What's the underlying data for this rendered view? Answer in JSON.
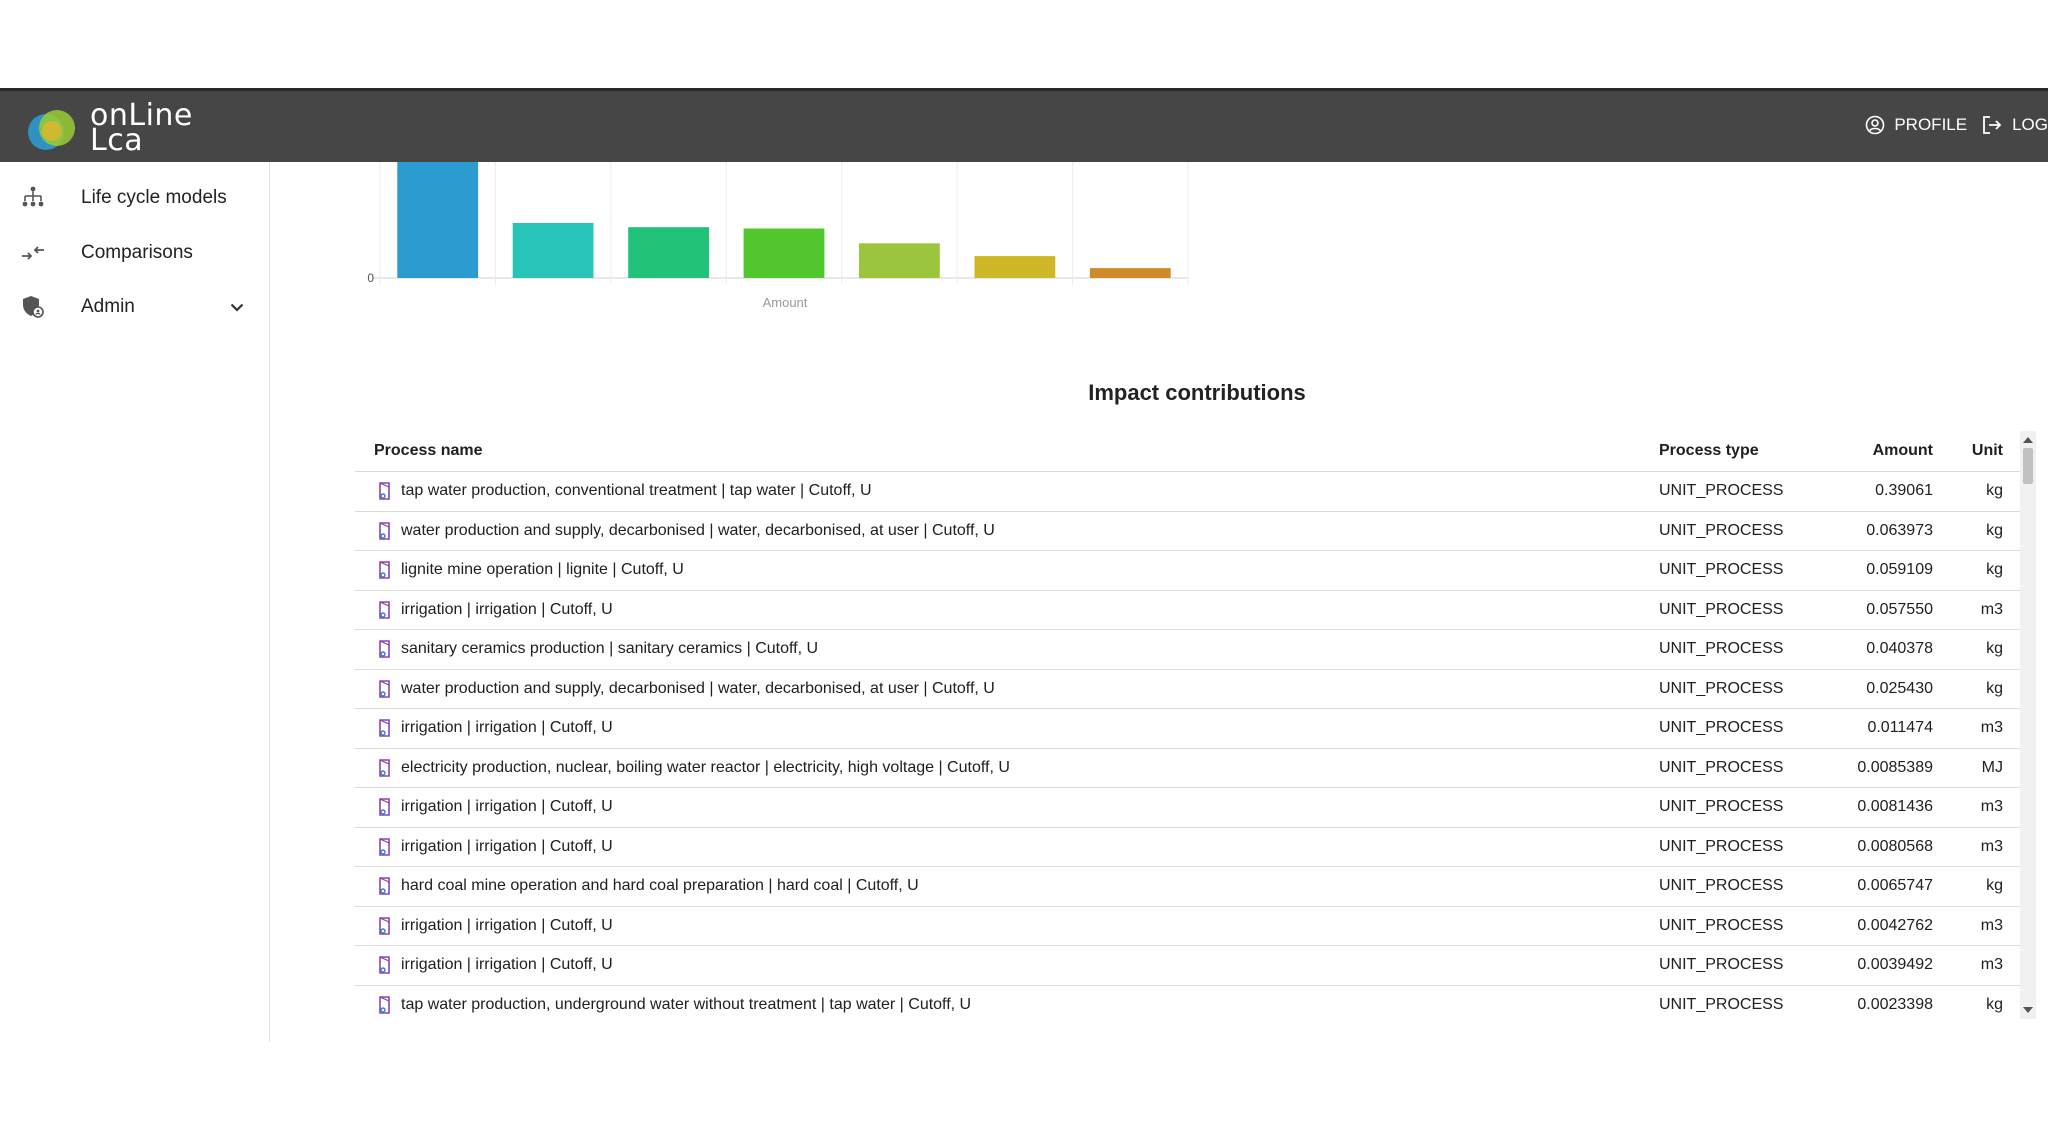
{
  "app": {
    "logo_line1": "onLine",
    "logo_line2": "Lca"
  },
  "header": {
    "profile_label": "PROFILE",
    "logout_label": "LOG"
  },
  "sidebar": {
    "items": [
      {
        "label": "Life cycle models",
        "icon": "sitemap-icon"
      },
      {
        "label": "Comparisons",
        "icon": "compare-arrows-icon"
      },
      {
        "label": "Admin",
        "icon": "admin-shield-icon"
      }
    ]
  },
  "chart_data": {
    "type": "bar",
    "xlabel": "Amount",
    "y_tick_labels": [
      "0"
    ],
    "values": [
      0.39061,
      0.063973,
      0.059109,
      0.05755,
      0.040378,
      0.02543,
      0.011474
    ],
    "colors": [
      "#2b9bd0",
      "#29c4b8",
      "#22c27a",
      "#52c72d",
      "#9cc43c",
      "#cfb828",
      "#cf8a2a"
    ]
  },
  "impact": {
    "title": "Impact contributions",
    "columns": {
      "name": "Process name",
      "type": "Process type",
      "amount": "Amount",
      "unit": "Unit"
    },
    "rows": [
      {
        "name": "tap water production, conventional treatment | tap water | Cutoff, U",
        "type": "UNIT_PROCESS",
        "amount": "0.39061",
        "unit": "kg"
      },
      {
        "name": "water production and supply, decarbonised | water, decarbonised, at user | Cutoff, U",
        "type": "UNIT_PROCESS",
        "amount": "0.063973",
        "unit": "kg"
      },
      {
        "name": "lignite mine operation | lignite | Cutoff, U",
        "type": "UNIT_PROCESS",
        "amount": "0.059109",
        "unit": "kg"
      },
      {
        "name": "irrigation | irrigation | Cutoff, U",
        "type": "UNIT_PROCESS",
        "amount": "0.057550",
        "unit": "m3"
      },
      {
        "name": "sanitary ceramics production | sanitary ceramics | Cutoff, U",
        "type": "UNIT_PROCESS",
        "amount": "0.040378",
        "unit": "kg"
      },
      {
        "name": "water production and supply, decarbonised | water, decarbonised, at user | Cutoff, U",
        "type": "UNIT_PROCESS",
        "amount": "0.025430",
        "unit": "kg"
      },
      {
        "name": "irrigation | irrigation | Cutoff, U",
        "type": "UNIT_PROCESS",
        "amount": "0.011474",
        "unit": "m3"
      },
      {
        "name": "electricity production, nuclear, boiling water reactor | electricity, high voltage | Cutoff, U",
        "type": "UNIT_PROCESS",
        "amount": "0.0085389",
        "unit": "MJ"
      },
      {
        "name": "irrigation | irrigation | Cutoff, U",
        "type": "UNIT_PROCESS",
        "amount": "0.0081436",
        "unit": "m3"
      },
      {
        "name": "irrigation | irrigation | Cutoff, U",
        "type": "UNIT_PROCESS",
        "amount": "0.0080568",
        "unit": "m3"
      },
      {
        "name": "hard coal mine operation and hard coal preparation | hard coal | Cutoff, U",
        "type": "UNIT_PROCESS",
        "amount": "0.0065747",
        "unit": "kg"
      },
      {
        "name": "irrigation | irrigation | Cutoff, U",
        "type": "UNIT_PROCESS",
        "amount": "0.0042762",
        "unit": "m3"
      },
      {
        "name": "irrigation | irrigation | Cutoff, U",
        "type": "UNIT_PROCESS",
        "amount": "0.0039492",
        "unit": "m3"
      },
      {
        "name": "tap water production, underground water without treatment | tap water | Cutoff, U",
        "type": "UNIT_PROCESS",
        "amount": "0.0023398",
        "unit": "kg"
      }
    ]
  },
  "colors": {
    "topbar": "#464646",
    "process_icon": "#8e44ad",
    "process_icon_accent": "#2f7bd6"
  }
}
